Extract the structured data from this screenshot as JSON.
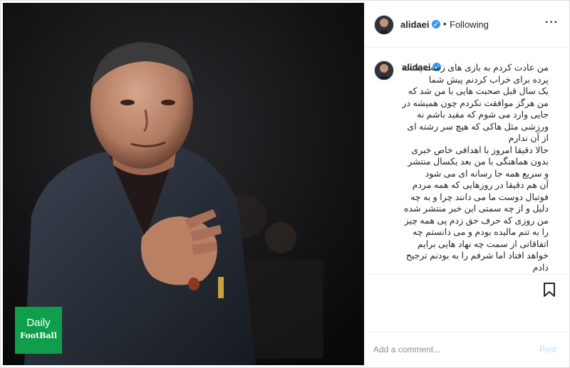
{
  "post": {
    "username": "alidaei",
    "follow_status": "Following",
    "header_separator": "•",
    "more_icon": "more-horizontal-icon",
    "caption_username": "alidaei",
    "caption": "من عادت کردم به بازی های زشت پشت پرده برای خراب کردنم پیش شما\nیک سال قبل صحبت هایی با من شد که من هرگز موافقت نکردم چون همیشه در جایی وارد می شوم که مفید باشم نه ورزشی مثل هاکی که هیچ سر رشته ای از آن ندارم\nحالا دقیقا امروز با اهدافی خاص خبری بدون هماهنگی با من بعد یکسال منتشر و سریع همه جا رسانه ای می شود\nآن هم دقیقا در روزهایی که همه مردم فوتبال دوست ما می دانند چرا و به چه دلیل و از چه سمتی این خبر منتشر شده\nمن روزی که حرف حق زدم پی همه چیز را به تنم مالیده بودم و می دانستم چه اتفاقاتی از سمت چه نهاد هایی برایم خواهد افتاد اما شرفم را به بودنم ترجیح دادم\nتنها چیزی که در این فوتبال برایم مهم",
    "add_comment_placeholder": "Add a comment...",
    "post_label": "Post",
    "bookmark_icon": "bookmark-icon"
  },
  "watermark": {
    "line1": "Daily",
    "line2": "FootBall"
  },
  "colors": {
    "verified": "#3897f0",
    "watermark_bg": "#0f9f4b",
    "post_disabled": "#b2dffc"
  }
}
